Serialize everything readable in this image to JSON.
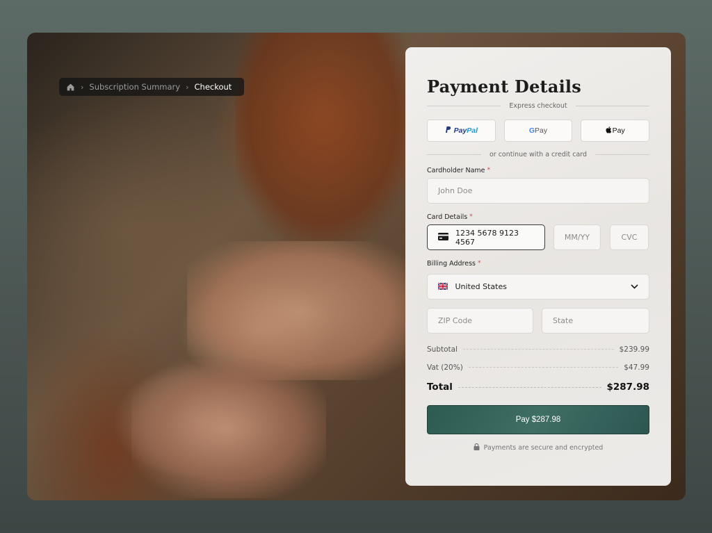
{
  "breadcrumb": {
    "items": [
      "Subscription Summary",
      "Checkout"
    ]
  },
  "payment": {
    "title": "Payment Details",
    "express_label": "Express checkout",
    "express_buttons": {
      "paypal_a": "Pay",
      "paypal_b": "Pal",
      "gpay_g": "G",
      "gpay_text": "Pay",
      "applepay_text": "Pay"
    },
    "continue_label": "or continue with a credit card",
    "cardholder": {
      "label": "Cardholder Name",
      "required": "*",
      "placeholder": "John Doe"
    },
    "card": {
      "label": "Card Details",
      "required": "*",
      "number": "1234 5678 9123 4567",
      "expiry_placeholder": "MM/YY",
      "cvc_placeholder": "CVC"
    },
    "billing": {
      "label": "Billing Address",
      "required": "*",
      "country": "United States",
      "zip_placeholder": "ZIP Code",
      "state_placeholder": "State"
    },
    "summary": {
      "subtotal_label": "Subtotal",
      "subtotal_value": "$239.99",
      "vat_label": "Vat (20%)",
      "vat_value": "$47.99",
      "total_label": "Total",
      "total_value": "$287.98"
    },
    "pay_button": "Pay $287.98",
    "secure_note": "Payments are secure and encrypted"
  },
  "colors": {
    "accent": "#2f5c54",
    "panel_bg": "#f2f1ef",
    "breadcrumb_bg": "#1a1a1a"
  }
}
